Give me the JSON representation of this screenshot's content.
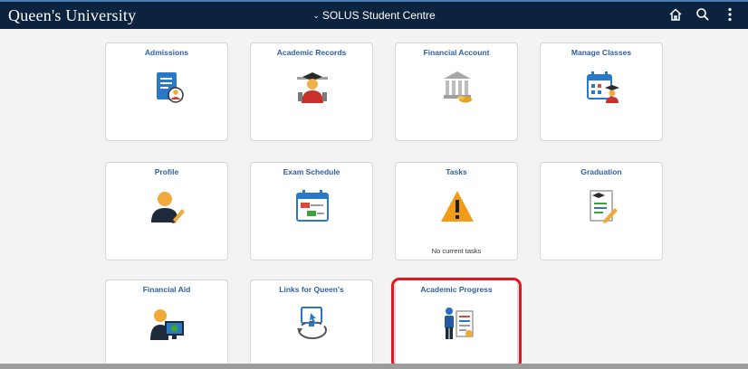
{
  "header": {
    "brand": "Queen's University",
    "title": "SOLUS Student Centre",
    "icons": [
      "home-icon",
      "search-icon",
      "more-icon"
    ]
  },
  "tiles": [
    {
      "label": "Admissions",
      "icon": "admissions-icon"
    },
    {
      "label": "Academic Records",
      "icon": "academic-records-icon"
    },
    {
      "label": "Financial Account",
      "icon": "financial-account-icon"
    },
    {
      "label": "Manage Classes",
      "icon": "manage-classes-icon"
    },
    {
      "label": "Profile",
      "icon": "profile-icon"
    },
    {
      "label": "Exam Schedule",
      "icon": "exam-schedule-icon"
    },
    {
      "label": "Tasks",
      "icon": "warning-icon",
      "subtext": "No current tasks"
    },
    {
      "label": "Graduation",
      "icon": "graduation-icon"
    },
    {
      "label": "Financial Aid",
      "icon": "financial-aid-icon"
    },
    {
      "label": "Links for Queen's",
      "icon": "links-icon"
    },
    {
      "label": "Academic Progress",
      "icon": "academic-progress-icon"
    }
  ],
  "colors": {
    "header_bg": "#0c2340",
    "tile_label": "#2c5fa8",
    "highlight": "#e2161c"
  }
}
